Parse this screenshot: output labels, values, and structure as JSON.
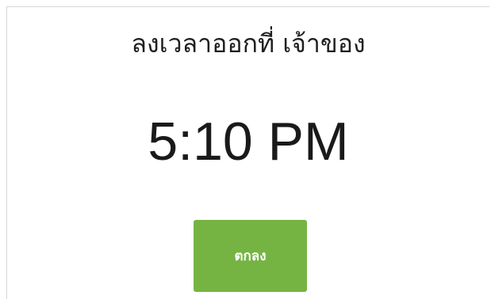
{
  "dialog": {
    "title": "ลงเวลาออกที่ เจ้าของ",
    "time": "5:10 PM",
    "ok_label": "ตกลง"
  },
  "colors": {
    "button_bg": "#75b443",
    "button_text": "#ffffff",
    "title_text": "#1f1f1f"
  }
}
